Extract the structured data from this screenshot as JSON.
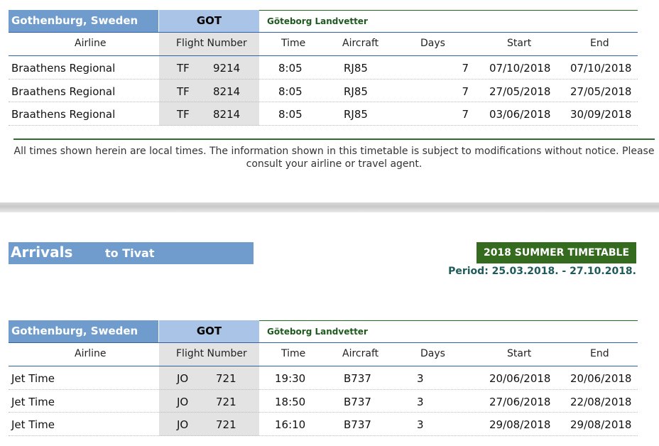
{
  "columns": {
    "airline": "Airline",
    "flight_number": "Flight Number",
    "time": "Time",
    "aircraft": "Aircraft",
    "days": "Days",
    "start": "Start",
    "end": "End"
  },
  "departures": {
    "city": "Gothenburg, Sweden",
    "code": "GOT",
    "airport": "Göteborg Landvetter",
    "rows": [
      {
        "airline": "Braathens Regional",
        "code": "TF",
        "number": "9214",
        "time": "8:05",
        "aircraft": "RJ85",
        "days": "7",
        "start": "07/10/2018",
        "end": "07/10/2018"
      },
      {
        "airline": "Braathens Regional",
        "code": "TF",
        "number": "8214",
        "time": "8:05",
        "aircraft": "RJ85",
        "days": "7",
        "start": "27/05/2018",
        "end": "27/05/2018"
      },
      {
        "airline": "Braathens Regional",
        "code": "TF",
        "number": "8214",
        "time": "8:05",
        "aircraft": "RJ85",
        "days": "7",
        "start": "03/06/2018",
        "end": "30/09/2018"
      }
    ]
  },
  "disclaimer": "All times shown herein are local times. The information shown in this timetable is subject to modifications without notice. Please consult your airline or travel agent.",
  "arrivals_header": {
    "title": "Arrivals",
    "destination": "to Tivat",
    "timetable_badge": "2018 SUMMER TIMETABLE",
    "period": "Period: 25.03.2018. - 27.10.2018."
  },
  "arrivals": {
    "city": "Gothenburg, Sweden",
    "code": "GOT",
    "airport": "Göteborg Landvetter",
    "rows": [
      {
        "airline": "Jet Time",
        "code": "JO",
        "number": "721",
        "time": "19:30",
        "aircraft": "B737",
        "days": "3",
        "start": "20/06/2018",
        "end": "20/06/2018"
      },
      {
        "airline": "Jet Time",
        "code": "JO",
        "number": "721",
        "time": "18:50",
        "aircraft": "B737",
        "days": "3",
        "start": "27/06/2018",
        "end": "22/08/2018"
      },
      {
        "airline": "Jet Time",
        "code": "JO",
        "number": "721",
        "time": "16:10",
        "aircraft": "B737",
        "days": "3",
        "start": "29/08/2018",
        "end": "29/08/2018"
      }
    ]
  }
}
